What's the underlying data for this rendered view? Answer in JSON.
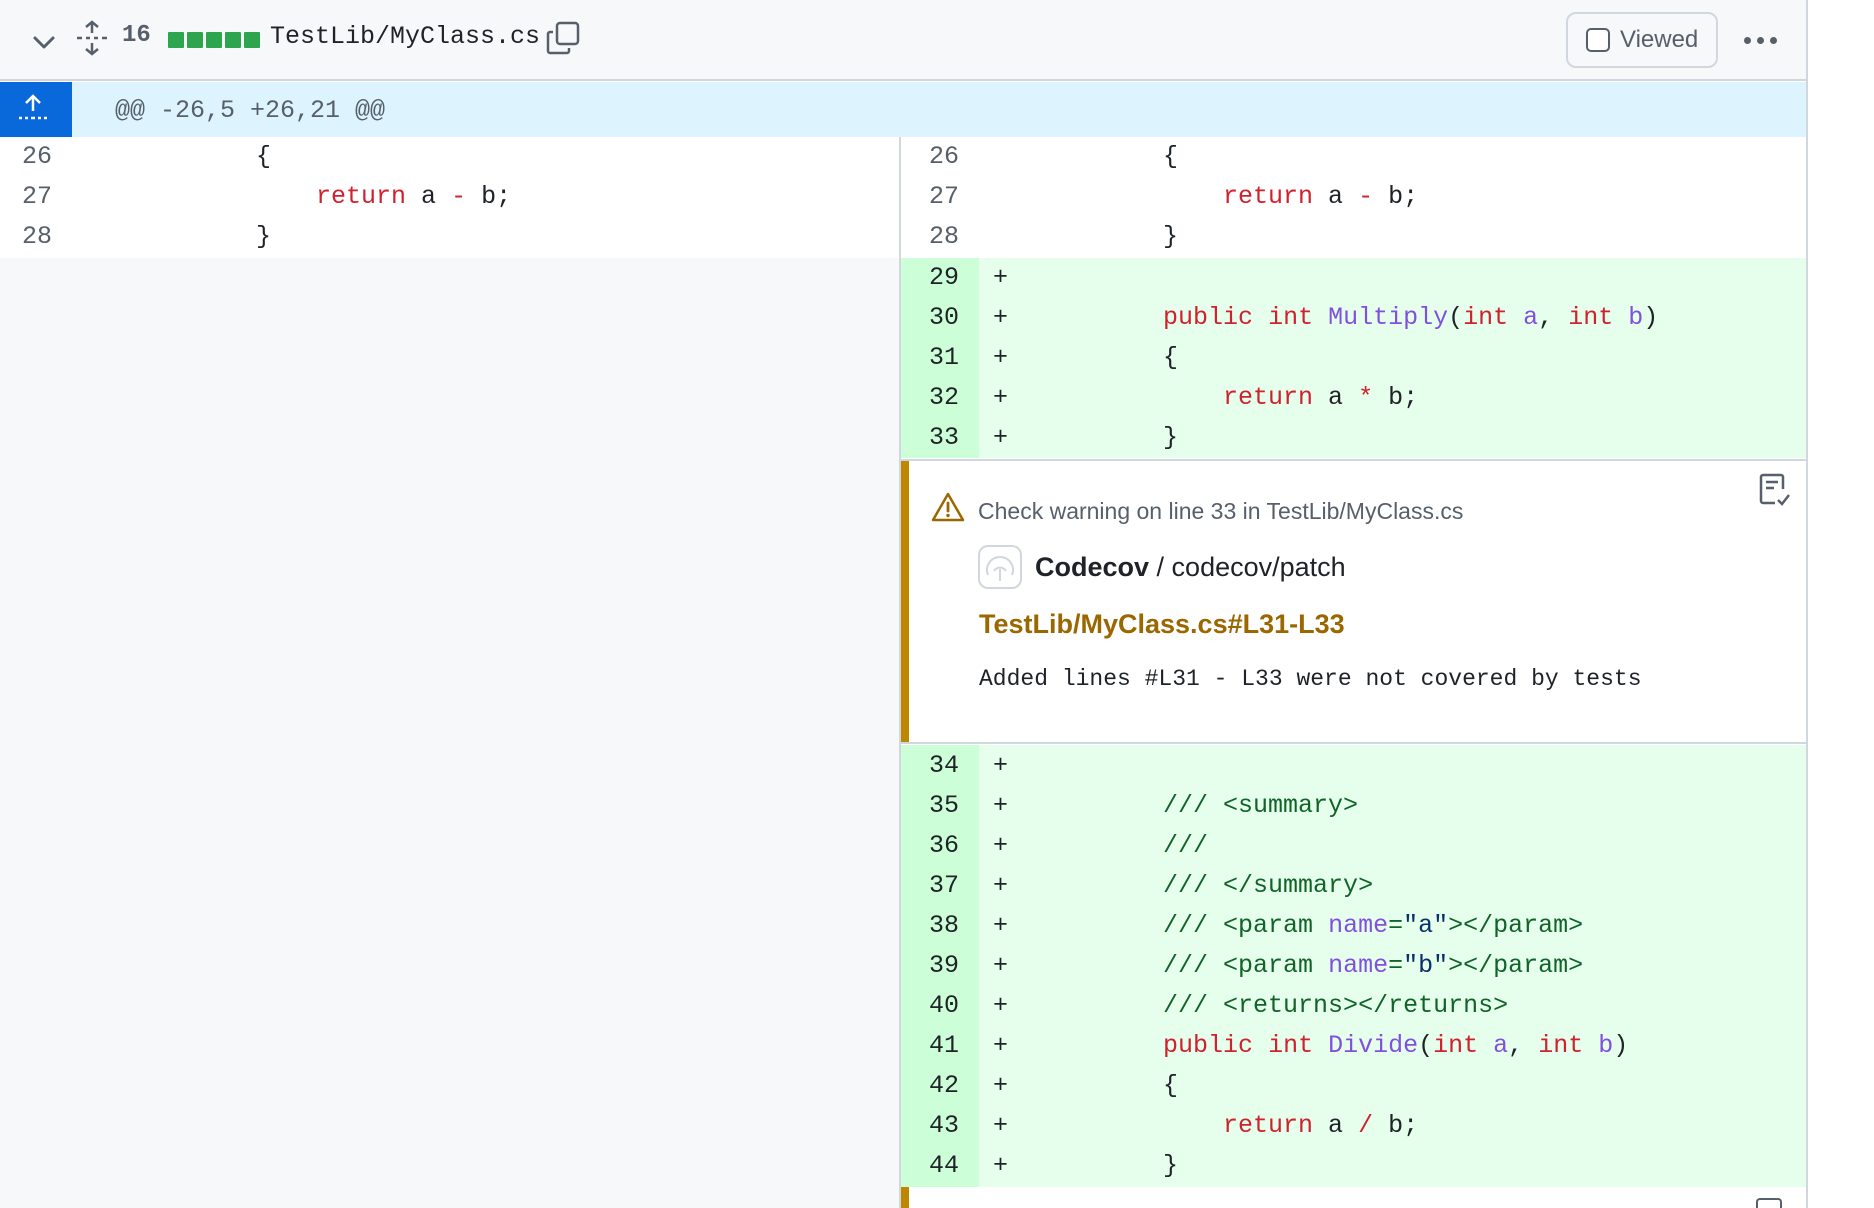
{
  "header": {
    "changes_count": "16",
    "diffstat_blocks": 5,
    "diffstat_color": "#2da44e",
    "file_path": "TestLib/MyClass.cs",
    "viewed_label": "Viewed",
    "viewed_checked": false,
    "icons": [
      "chevron-down-icon",
      "unfold-icon",
      "copy-icon",
      "kebab-horizontal-icon"
    ]
  },
  "hunk": {
    "header": "@@ -26,5 +26,21 @@",
    "icon": "expand-up-icon"
  },
  "left_lines": [
    {
      "num": "26",
      "code": "        {"
    },
    {
      "num": "27",
      "code": "            return a - b;"
    },
    {
      "num": "28",
      "code": "        }"
    }
  ],
  "right_context": [
    {
      "num": "26",
      "code": "        {"
    },
    {
      "num": "27",
      "code": "            return a - b;"
    },
    {
      "num": "28",
      "code": "        }"
    }
  ],
  "added_block_1": [
    {
      "num": "29",
      "sign": "+",
      "code": ""
    },
    {
      "num": "30",
      "sign": "+",
      "code": "        public int Multiply(int a, int b)"
    },
    {
      "num": "31",
      "sign": "+",
      "code": "        {"
    },
    {
      "num": "32",
      "sign": "+",
      "code": "            return a * b;"
    },
    {
      "num": "33",
      "sign": "+",
      "code": "        }"
    }
  ],
  "annotation": {
    "title": "Check warning on line 33 in TestLib/MyClass.cs",
    "app_name": "Codecov",
    "app_separator": " / ",
    "check_name": "codecov/patch",
    "link": "TestLib/MyClass.cs#L31-L33",
    "message": "Added lines #L31 - L33 were not covered by tests",
    "accent_color": "#bf8700",
    "icons": [
      "alert-icon",
      "codecov-logo",
      "checklist-icon"
    ]
  },
  "added_block_2": [
    {
      "num": "34",
      "sign": "+",
      "code": ""
    },
    {
      "num": "35",
      "sign": "+",
      "code": "        /// <summary>"
    },
    {
      "num": "36",
      "sign": "+",
      "code": "        ///"
    },
    {
      "num": "37",
      "sign": "+",
      "code": "        /// </summary>"
    },
    {
      "num": "38",
      "sign": "+",
      "code": "        /// <param name=\"a\"></param>"
    },
    {
      "num": "39",
      "sign": "+",
      "code": "        /// <param name=\"b\"></param>"
    },
    {
      "num": "40",
      "sign": "+",
      "code": "        /// <returns></returns>"
    },
    {
      "num": "41",
      "sign": "+",
      "code": "        public int Divide(int a, int b)"
    },
    {
      "num": "42",
      "sign": "+",
      "code": "        {"
    },
    {
      "num": "43",
      "sign": "+",
      "code": "            return a / b;"
    },
    {
      "num": "44",
      "sign": "+",
      "code": "        }"
    }
  ],
  "colors": {
    "addition_bg": "#e6ffec",
    "addition_num_bg": "#ccffd8",
    "hunk_bg": "#ddf4ff",
    "expand_btn": "#0969da",
    "keyword": "#cf222e",
    "function": "#8250df",
    "comment": "#116329",
    "string": "#0a3069"
  }
}
